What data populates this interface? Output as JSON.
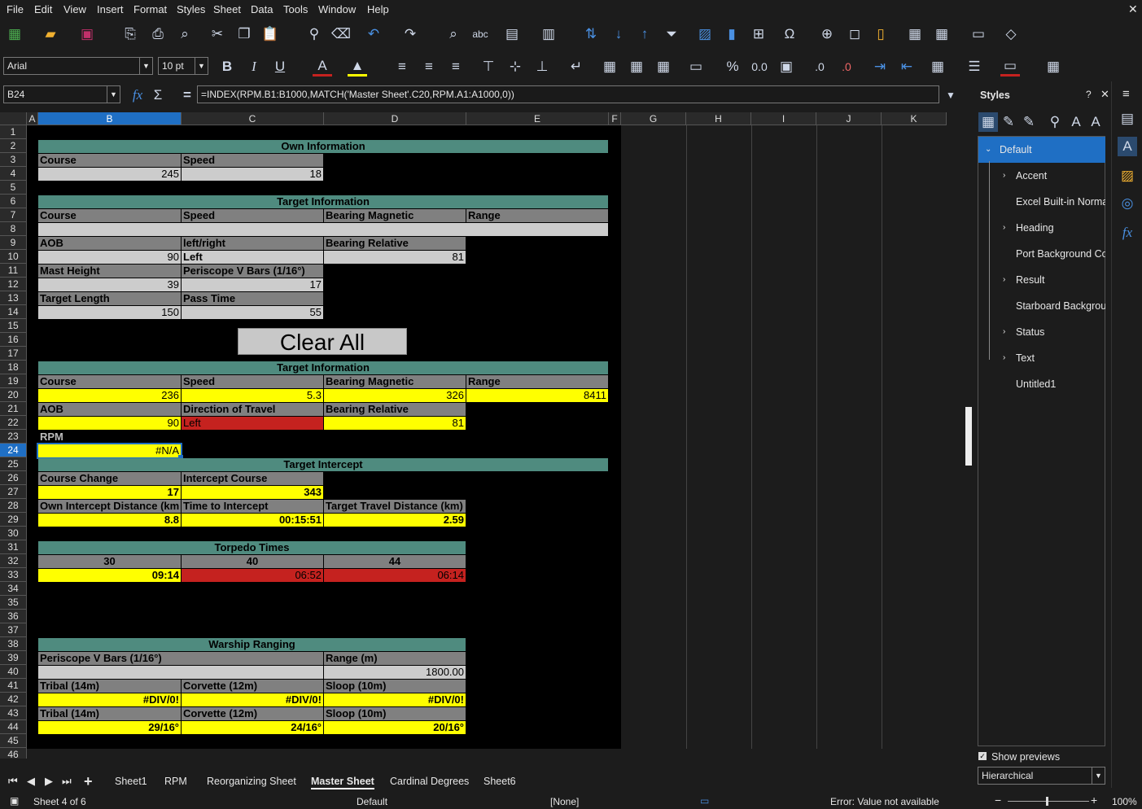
{
  "menu": [
    "File",
    "Edit",
    "View",
    "Insert",
    "Format",
    "Styles",
    "Sheet",
    "Data",
    "Tools",
    "Window",
    "Help"
  ],
  "font": {
    "name": "Arial",
    "size": "10 pt"
  },
  "namebox": "B24",
  "formula": "=INDEX(RPM.B1:B1000,MATCH('Master Sheet'.C20,RPM.A1:A1000,0))",
  "columns": [
    "A",
    "B",
    "C",
    "D",
    "E",
    "F",
    "G",
    "H",
    "I",
    "J",
    "K"
  ],
  "rows": [
    "1",
    "2",
    "3",
    "4",
    "5",
    "6",
    "7",
    "8",
    "9",
    "10",
    "11",
    "12",
    "13",
    "14",
    "15",
    "16",
    "17",
    "18",
    "19",
    "20",
    "21",
    "22",
    "23",
    "24",
    "25",
    "26",
    "27",
    "28",
    "29",
    "30",
    "31",
    "32",
    "33",
    "34",
    "35",
    "36",
    "37",
    "38",
    "39",
    "40",
    "41",
    "42",
    "43",
    "44",
    "45",
    "46"
  ],
  "sheet": {
    "own_title": "Own Information",
    "own_course_lbl": "Course",
    "own_speed_lbl": "Speed",
    "own_course": "245",
    "own_speed": "18",
    "ti1_title": "Target Information",
    "ti1_course": "Course",
    "ti1_speed": "Speed",
    "ti1_bm": "Bearing Magnetic",
    "ti1_range": "Range",
    "aob_lbl": "AOB",
    "lr_lbl": "left/right",
    "br_lbl": "Bearing Relative",
    "aob": "90",
    "lr": "Left",
    "br": "81",
    "mh_lbl": "Mast Height",
    "pvb_lbl": "Periscope V Bars (1/16°)",
    "mh": "39",
    "pvb": "17",
    "tl_lbl": "Target Length",
    "pt_lbl": "Pass Time",
    "tl": "150",
    "pt": "55",
    "clear_all": "Clear All",
    "ti2_title": "Target Information",
    "ti2_course": "Course",
    "ti2_speed": "Speed",
    "ti2_bm": "Bearing Magnetic",
    "ti2_range": "Range",
    "ti2_course_v": "236",
    "ti2_speed_v": "5.3",
    "ti2_bm_v": "326",
    "ti2_range_v": "8411",
    "aob2_lbl": "AOB",
    "dot_lbl": "Direction of Travel",
    "br2_lbl": "Bearing Relative",
    "aob2": "90",
    "dot": "Left",
    "br2": "81",
    "rpm_lbl": "RPM",
    "rpm": "#N/A",
    "tint_title": "Target Intercept",
    "cc_lbl": "Course Change",
    "ic_lbl": "Intercept Course",
    "cc": "17",
    "ic": "343",
    "oid_lbl": "Own Intercept Distance (km",
    "tti_lbl": "Time to Intercept",
    "ttd_lbl": "Target Travel Distance (km)",
    "oid": "8.8",
    "tti": "00:15:51",
    "ttd": "2.59",
    "tt_title": "Torpedo Times",
    "tt1": "30",
    "tt2": "40",
    "tt3": "44",
    "tt1v": "09:14",
    "tt2v": "06:52",
    "tt3v": "06:14",
    "wr_title": "Warship Ranging",
    "wr_pvb": "Periscope V Bars (1/16°)",
    "wr_range": "Range (m)",
    "wr_range_v": "1800.00",
    "tribal": "Tribal (14m)",
    "corvette": "Corvette (12m)",
    "sloop": "Sloop (10m)",
    "div0": "#DIV/0!",
    "tribal_b": "29/16°",
    "corvette_b": "24/16°",
    "sloop_b": "20/16°"
  },
  "sidebar": {
    "title": "Styles",
    "items": [
      "Default",
      "Accent",
      "Excel Built-in Norma",
      "Heading",
      "Port Background Col",
      "Result",
      "Starboard Backgrour",
      "Status",
      "Text",
      "Untitled1"
    ],
    "show_previews": "Show previews",
    "mode": "Hierarchical"
  },
  "tabs": [
    "Sheet1",
    "RPM",
    "Reorganizing Sheet",
    "Master Sheet",
    "Cardinal Degrees",
    "Sheet6"
  ],
  "status": {
    "sheet": "Sheet 4 of 6",
    "style": "Default",
    "lang": "[None]",
    "error": "Error: Value not available",
    "zoom": "100%"
  }
}
